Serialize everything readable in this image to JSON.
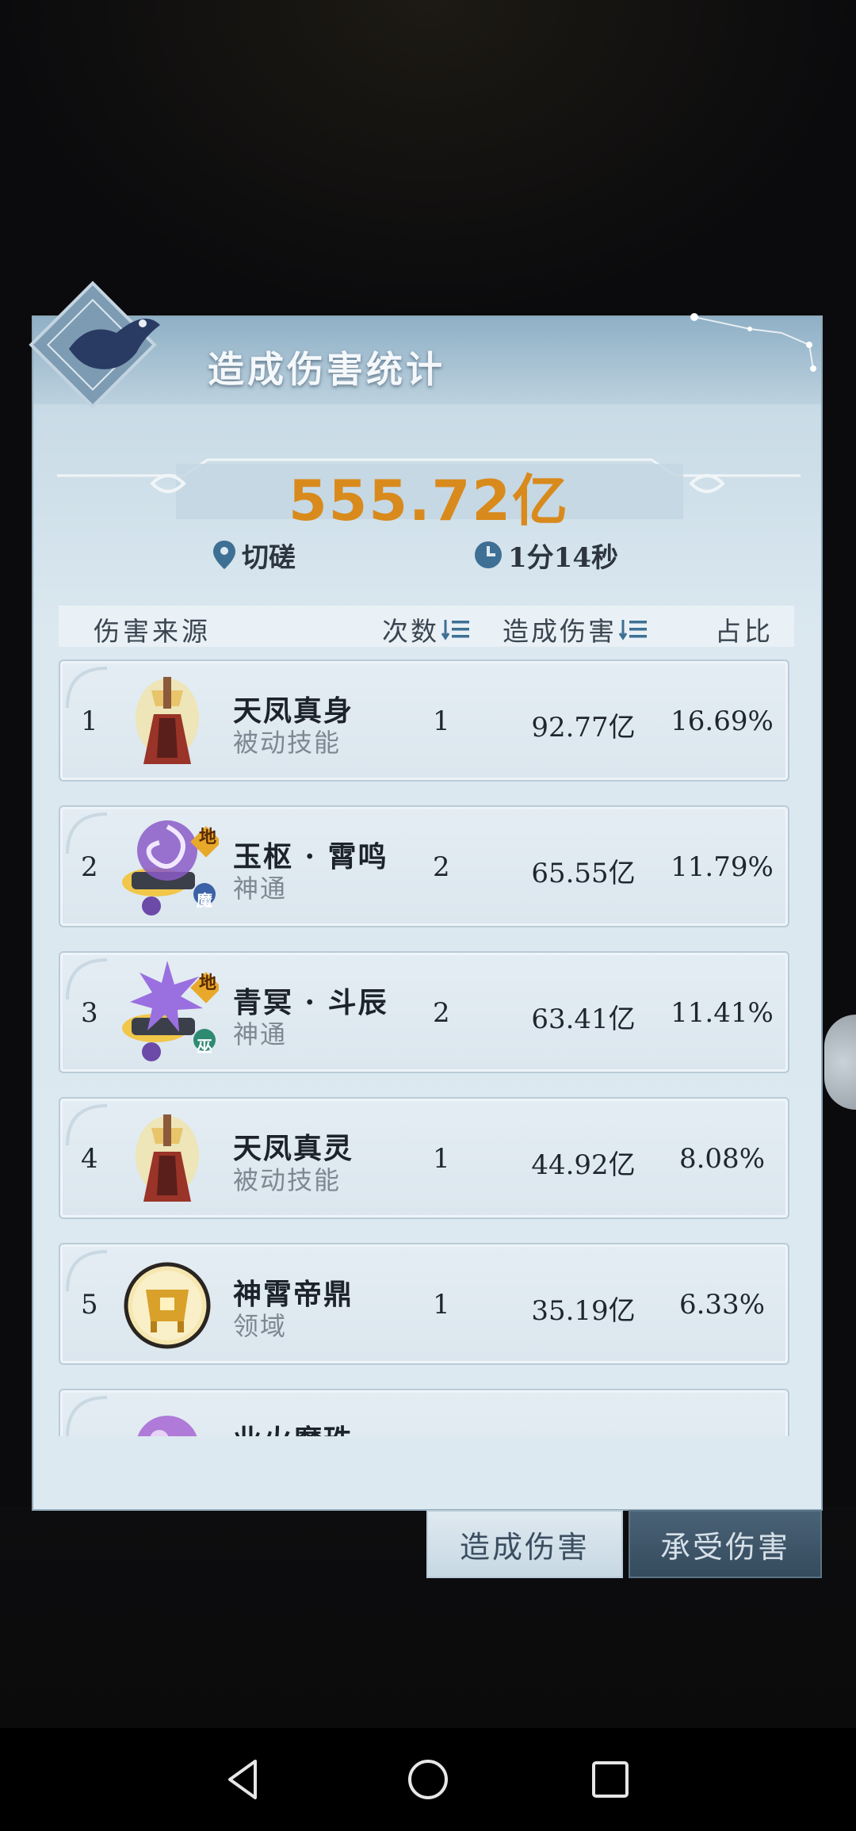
{
  "panel": {
    "title": "造成伤害统计",
    "total_damage": "555.72亿",
    "location": "切磋",
    "duration": "1分14秒"
  },
  "table": {
    "headers": {
      "source": "伤害来源",
      "count": "次数",
      "damage": "造成伤害",
      "ratio": "占比"
    },
    "rows": [
      {
        "rank": "1",
        "name": "天凤真身",
        "type": "被动技能",
        "count": "1",
        "damage": "92.77亿",
        "ratio": "16.69%",
        "icon": "phoenix-statue-icon"
      },
      {
        "rank": "2",
        "name": "玉枢 · 霄鸣",
        "type": "神通",
        "count": "2",
        "damage": "65.55亿",
        "ratio": "11.79%",
        "icon": "purple-vortex-scroll-icon",
        "badge_top": "地",
        "badge_bottom": "魔"
      },
      {
        "rank": "3",
        "name": "青冥 · 斗辰",
        "type": "神通",
        "count": "2",
        "damage": "63.41亿",
        "ratio": "11.41%",
        "icon": "purple-burst-scroll-icon",
        "badge_top": "地",
        "badge_bottom": "巫"
      },
      {
        "rank": "4",
        "name": "天凤真灵",
        "type": "被动技能",
        "count": "1",
        "damage": "44.92亿",
        "ratio": "8.08%",
        "icon": "phoenix-statue-icon"
      },
      {
        "rank": "5",
        "name": "神霄帝鼎",
        "type": "领域",
        "count": "1",
        "damage": "35.19亿",
        "ratio": "6.33%",
        "icon": "golden-cauldron-icon"
      },
      {
        "rank": "",
        "name": "业火魔珠",
        "type": "",
        "count": "",
        "damage": "",
        "ratio": "",
        "icon": "purple-orb-icon"
      }
    ]
  },
  "tabs": {
    "dealt": "造成伤害",
    "taken": "承受伤害"
  },
  "colors": {
    "total_value": "#d98a1c",
    "panel_bg": "#dde9f1",
    "active_tab": "#c7d8e3",
    "inactive_tab": "#354b5e"
  }
}
